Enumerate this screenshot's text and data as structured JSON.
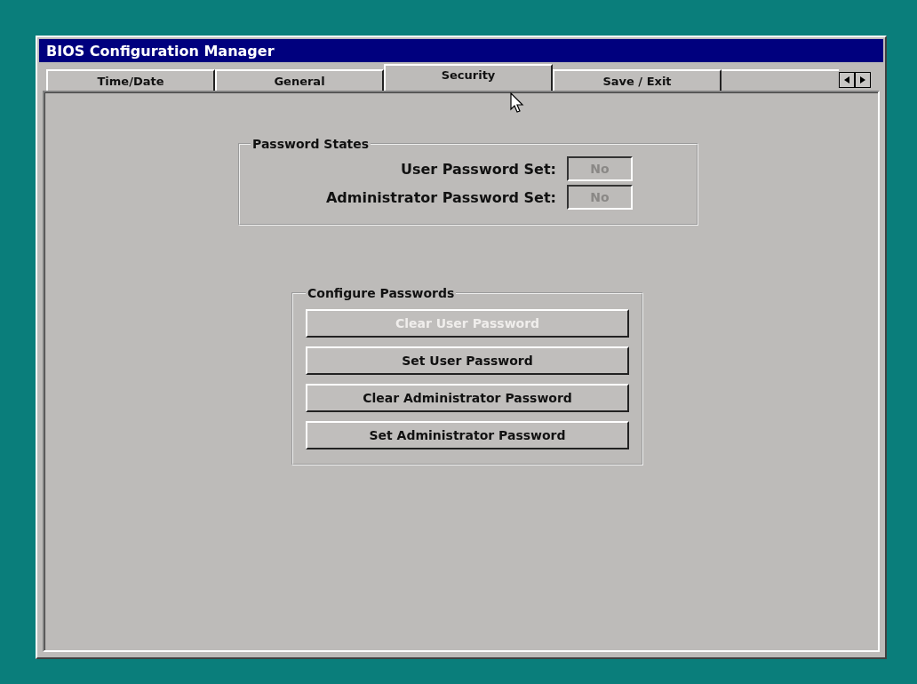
{
  "window": {
    "title": "BIOS Configuration Manager"
  },
  "tabs": [
    {
      "label": "Time/Date",
      "selected": false
    },
    {
      "label": "General",
      "selected": false
    },
    {
      "label": "Security",
      "selected": true
    },
    {
      "label": "Save / Exit",
      "selected": false
    }
  ],
  "password_states": {
    "title": "Password States",
    "fields": [
      {
        "label": "User Password Set:",
        "value": "No"
      },
      {
        "label": "Administrator Password Set:",
        "value": "No"
      }
    ]
  },
  "configure_passwords": {
    "title": "Configure Passwords",
    "buttons": [
      {
        "label": "Clear User Password",
        "disabled": true
      },
      {
        "label": "Set User Password",
        "disabled": false
      },
      {
        "label": "Clear Administrator Password",
        "disabled": false
      },
      {
        "label": "Set Administrator Password",
        "disabled": false
      }
    ]
  }
}
